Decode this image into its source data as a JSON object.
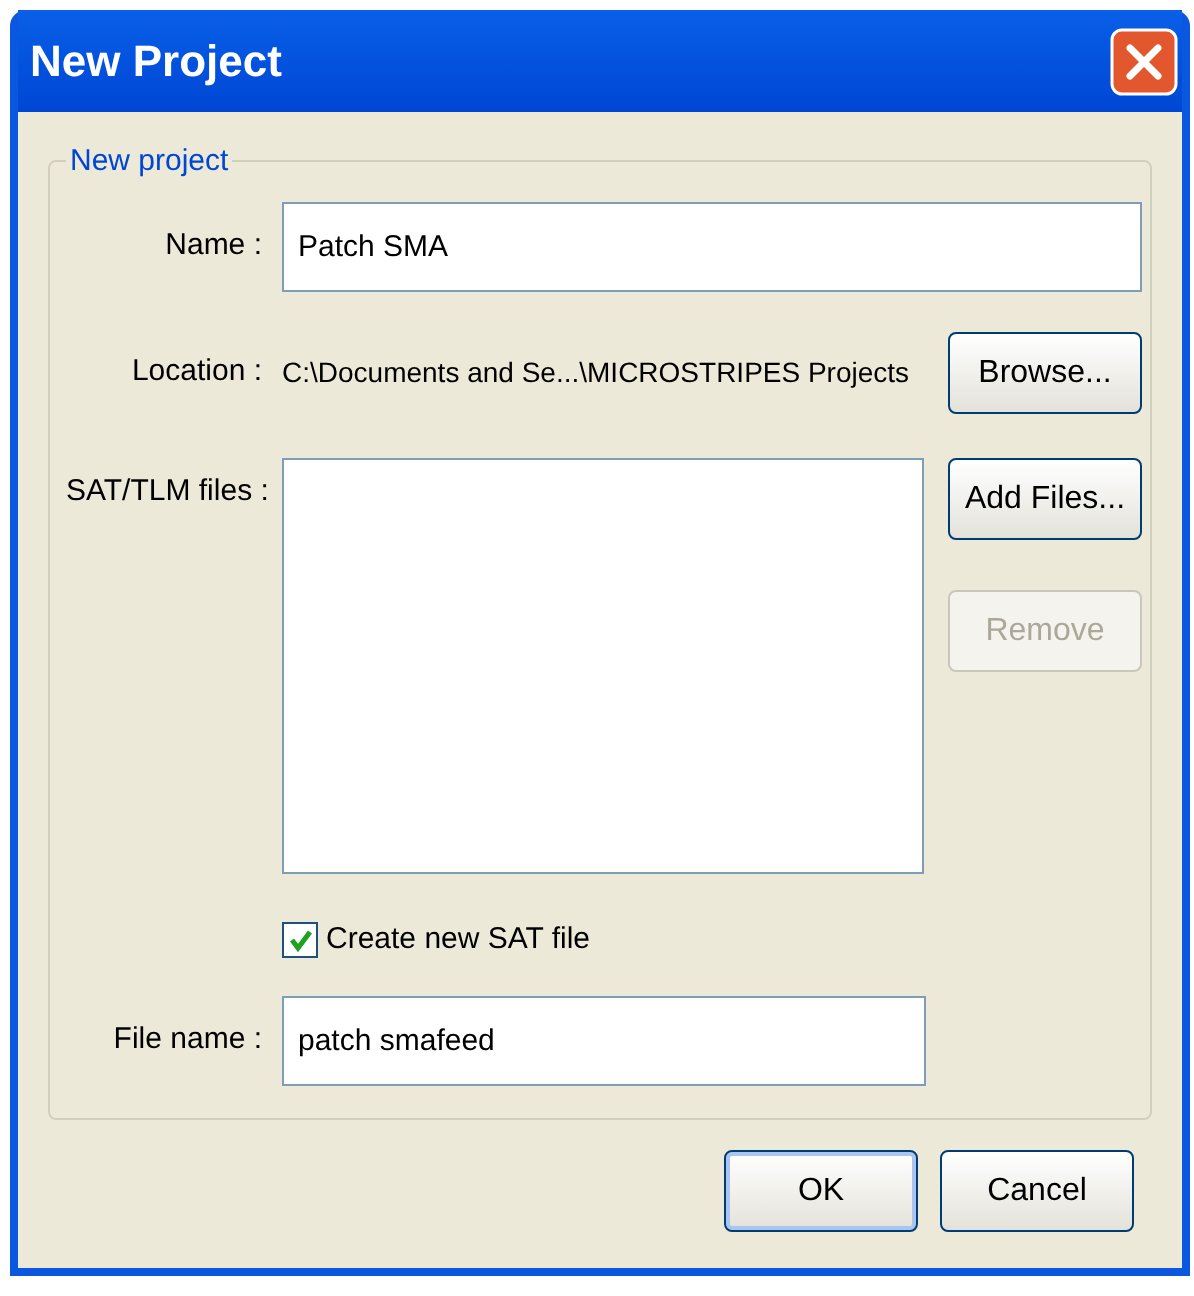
{
  "window": {
    "title": "New Project"
  },
  "group": {
    "legend": "New project"
  },
  "name": {
    "label": "Name :",
    "value": "Patch SMA"
  },
  "location": {
    "label": "Location :",
    "value": "C:\\Documents and Se...\\MICROSTRIPES Projects",
    "button": "Browse..."
  },
  "files": {
    "label": "SAT/TLM files :"
  },
  "side_buttons": [
    {
      "label": "Add Files...",
      "disabled": false
    },
    {
      "label": "Remove",
      "disabled": true
    }
  ],
  "create_new_sat": {
    "label": "Create new SAT file",
    "checked": true
  },
  "file_name": {
    "label": "File name :",
    "value": "patch smafeed"
  },
  "buttons": [
    {
      "label": "OK",
      "default": true
    },
    {
      "label": "Cancel",
      "default": false
    }
  ]
}
